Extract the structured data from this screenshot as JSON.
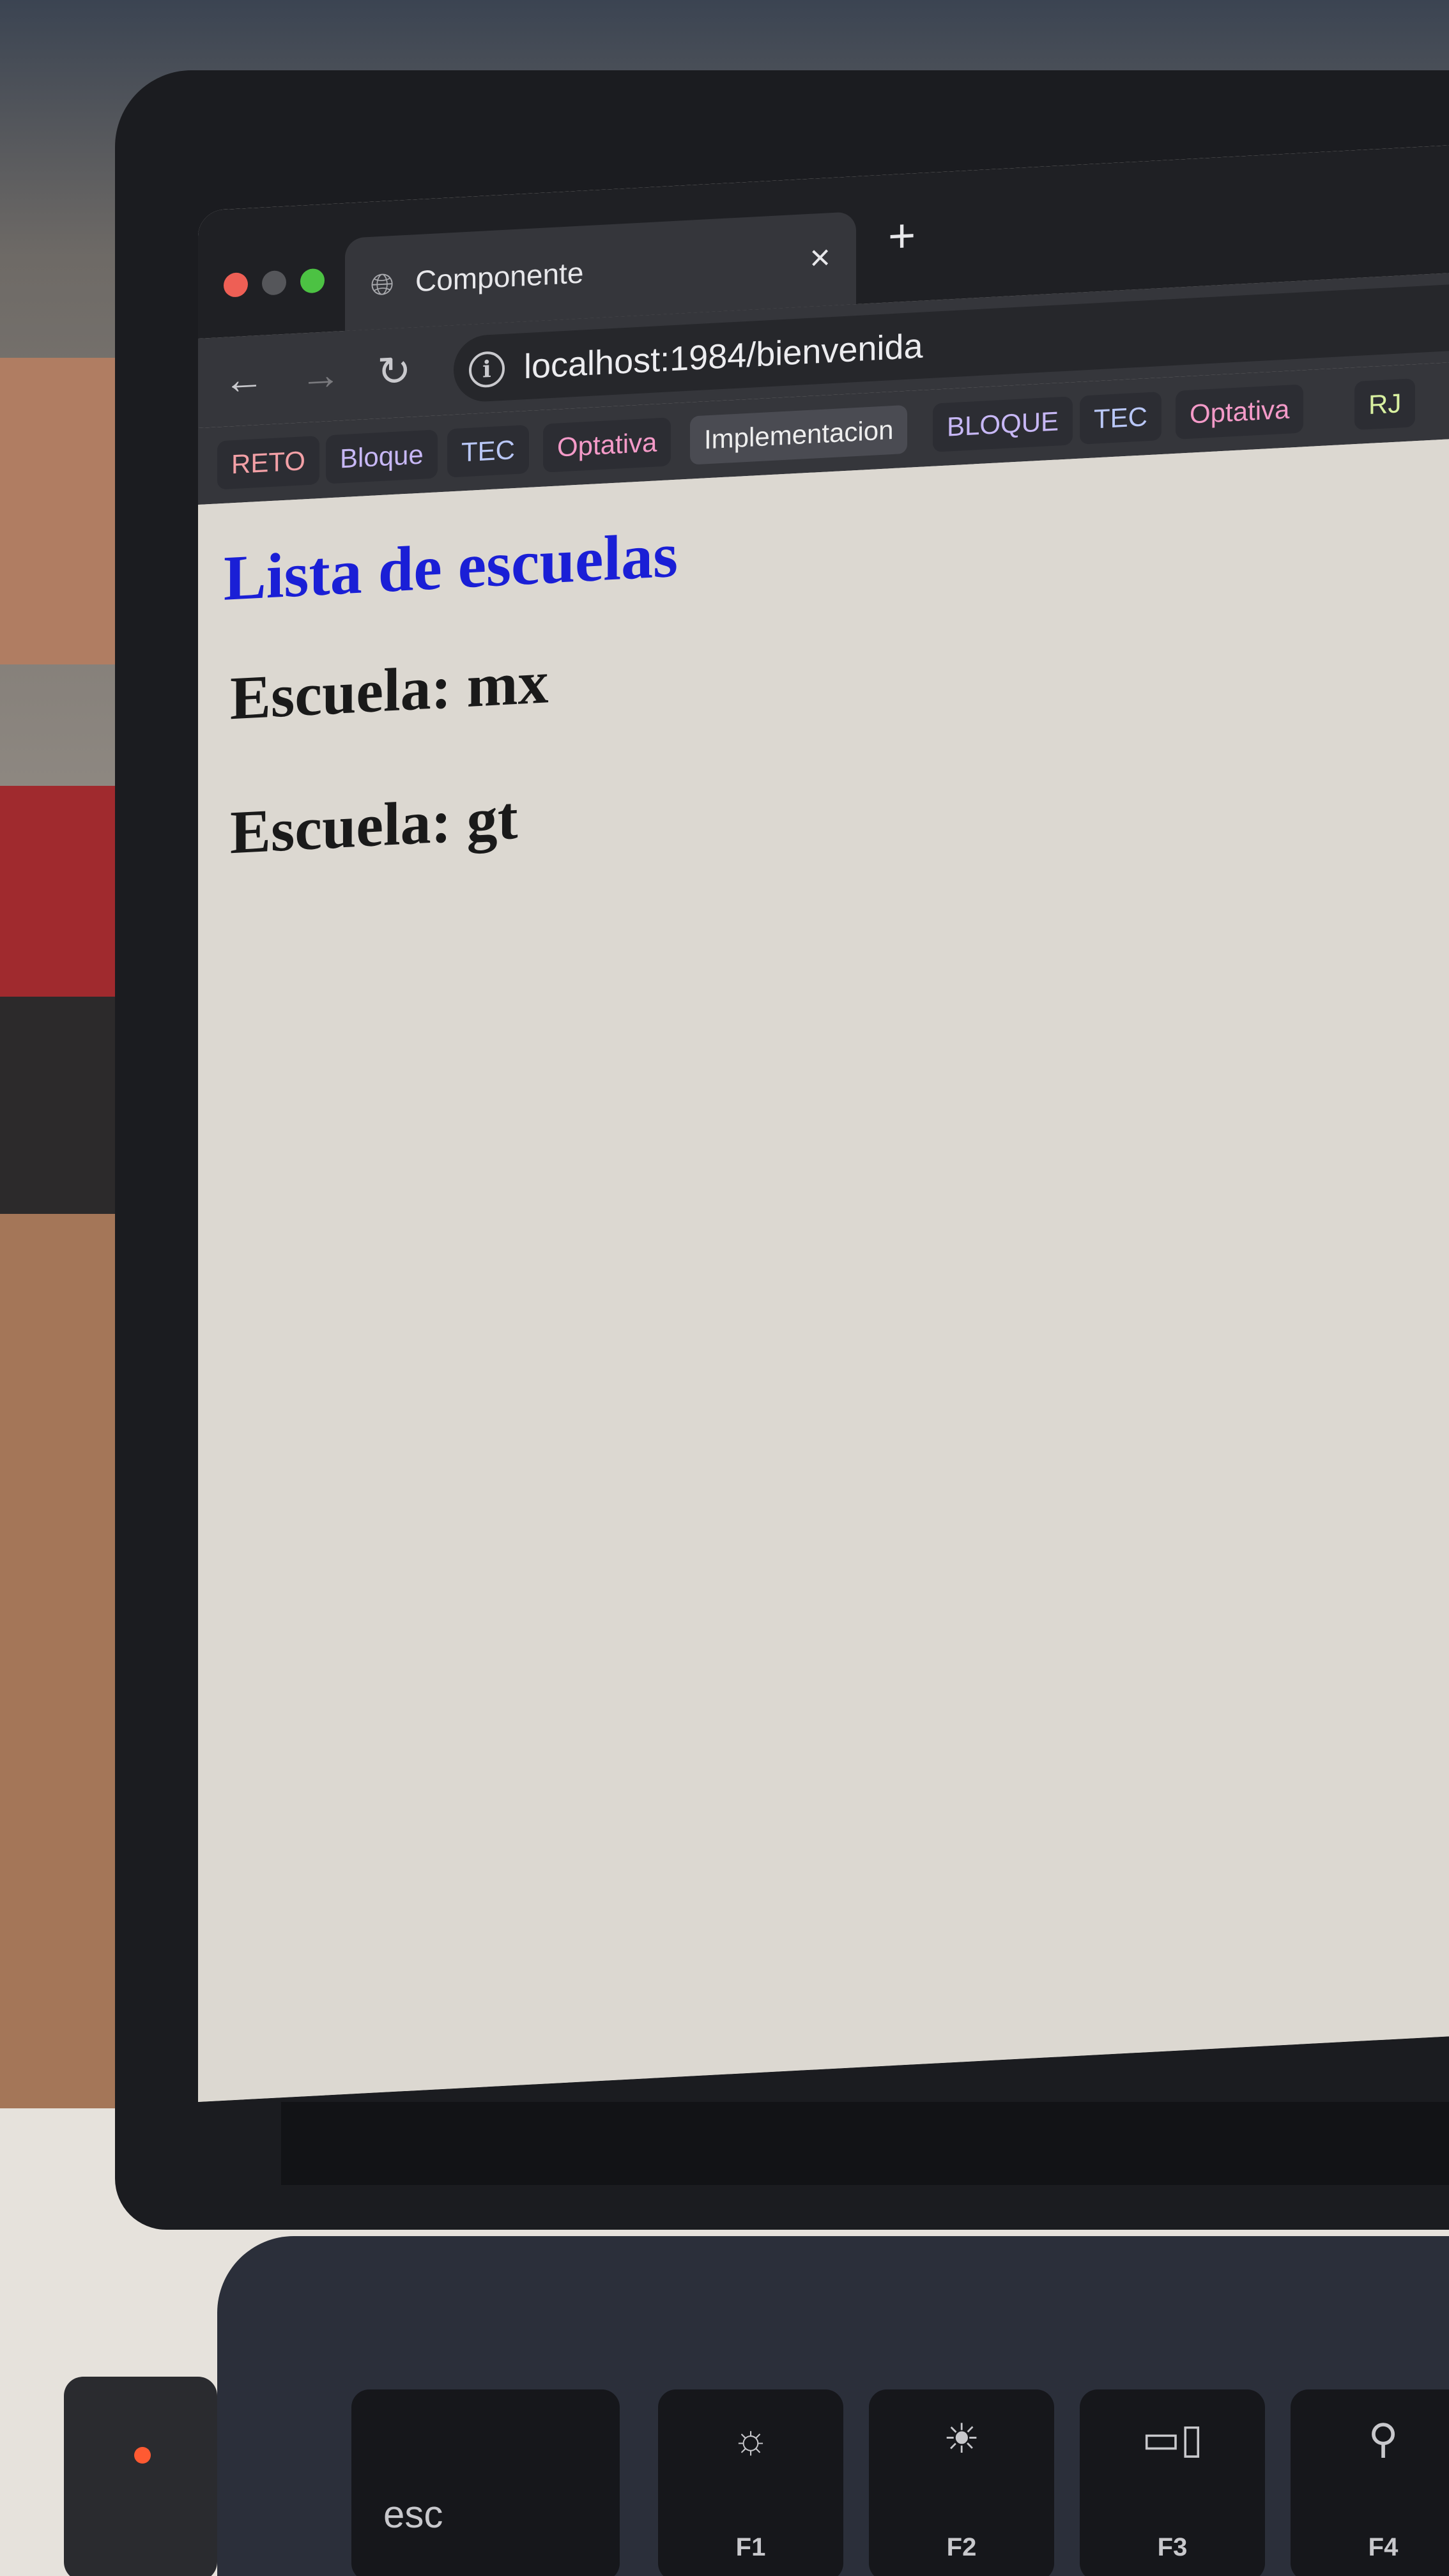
{
  "browser": {
    "tab_title": "Componente",
    "tab_close": "×",
    "new_tab": "+",
    "url": "localhost:1984/bienvenida",
    "nav": {
      "back": "←",
      "forward": "→",
      "reload": "↻"
    }
  },
  "bookmarks": [
    {
      "label": "RETO",
      "color": "#f3a0a6"
    },
    {
      "label": "Bloque",
      "color": "#c7b7f5"
    },
    {
      "label": "TEC",
      "color": "#b9c7f7"
    },
    {
      "label": "Optativa",
      "color": "#f49ac8"
    },
    {
      "label": "Implementacion",
      "color": "#eeeeee"
    },
    {
      "label": "BLOQUE",
      "color": "#c7b7f5"
    },
    {
      "label": "TEC",
      "color": "#b9c7f7"
    },
    {
      "label": "Optativa",
      "color": "#f49ac8"
    },
    {
      "label": "RJ",
      "color": "#d8f0a0"
    }
  ],
  "page": {
    "heading": "Lista de escuelas",
    "heading_color": "#1a1fd6",
    "schools": [
      "Escuela: mx",
      "Escuela: gt"
    ]
  },
  "keyboard": {
    "keys": [
      {
        "label": "esc",
        "icon": ""
      },
      {
        "label": "F1",
        "icon": "☼"
      },
      {
        "label": "F2",
        "icon": "☀"
      },
      {
        "label": "F3",
        "icon": "▭▯"
      },
      {
        "label": "F4",
        "icon": "⚲"
      }
    ]
  }
}
